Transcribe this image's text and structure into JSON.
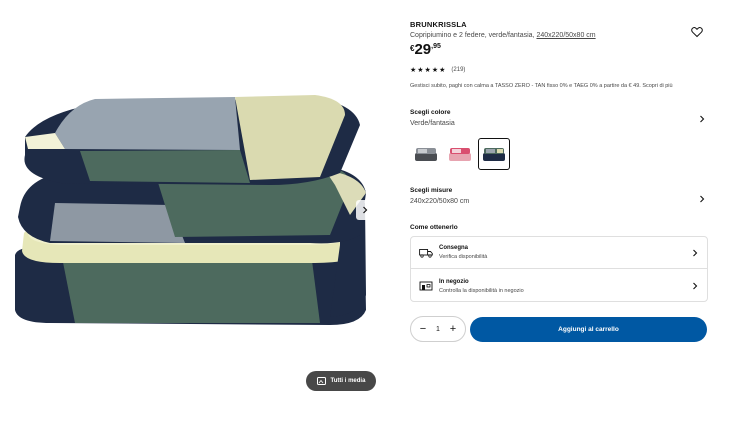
{
  "product": {
    "name": "BRUNKRISSLA",
    "description": "Copripiumino e 2 federe, verde/fantasia, ",
    "size_link": "240x220/50x80 cm",
    "price_currency": "€",
    "price_integer": "29",
    "price_decimal": ",95",
    "stars": "★★★★★",
    "rating_count": "(219)",
    "financing": "Gestisci subito, paghi con calma a TASSO ZERO - TAN fisso 0% e TAEG 0% a partire da € 49. Scopri di più"
  },
  "color": {
    "label": "Scegli colore",
    "value": "Verde/fantasia",
    "swatches": [
      {
        "name": "grigio",
        "selected": false
      },
      {
        "name": "rosa",
        "selected": false
      },
      {
        "name": "verde",
        "selected": true
      }
    ]
  },
  "size": {
    "label": "Scegli misure",
    "value": "240x220/50x80 cm"
  },
  "obtain": {
    "title": "Come ottenerlo",
    "delivery_title": "Consegna",
    "delivery_sub": "Verifica disponibilità",
    "store_title": "In negozio",
    "store_sub": "Controlla la disponibilità in negozio"
  },
  "quantity": {
    "minus": "−",
    "value": "1",
    "plus": "+"
  },
  "actions": {
    "add_to_cart": "Aggiungi al carrello",
    "all_media": "Tutti i media"
  },
  "colors": {
    "accent": "#0058a3",
    "navy": "#1e2b45",
    "green": "#4d6a5e",
    "yellow": "#e6e7b8"
  }
}
